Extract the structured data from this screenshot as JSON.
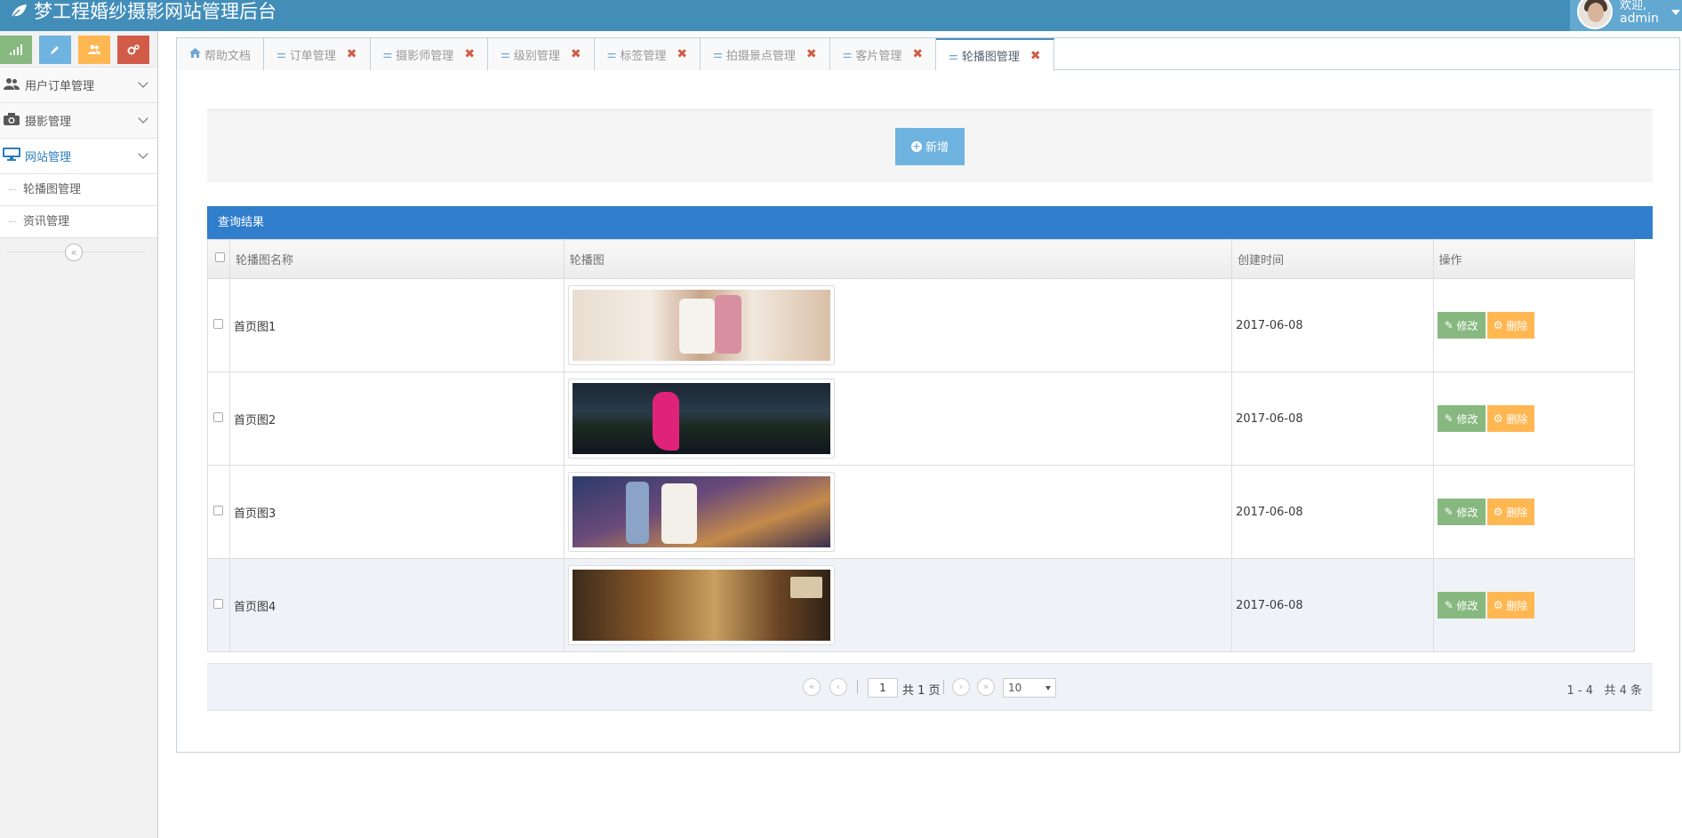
{
  "app": {
    "title": "梦工程婚纱摄影网站管理后台"
  },
  "user": {
    "welcome": "欢迎,",
    "name": "admin"
  },
  "sidebar": {
    "items": [
      {
        "label": "用户订单管理",
        "icon": "users-icon"
      },
      {
        "label": "摄影管理",
        "icon": "camera-icon"
      },
      {
        "label": "网站管理",
        "icon": "desktop-icon"
      }
    ],
    "subitems": [
      {
        "label": "轮播图管理"
      },
      {
        "label": "资讯管理"
      }
    ]
  },
  "tabs": [
    {
      "label": "帮助文档",
      "icon": "home-icon"
    },
    {
      "label": "订单管理"
    },
    {
      "label": "摄影师管理"
    },
    {
      "label": "级别管理"
    },
    {
      "label": "标签管理"
    },
    {
      "label": "拍摄景点管理"
    },
    {
      "label": "客片管理"
    },
    {
      "label": "轮播图管理"
    }
  ],
  "toolbar": {
    "add_label": "新增"
  },
  "results": {
    "title": "查询结果",
    "columns": [
      "轮播图名称",
      "轮播图",
      "创建时间",
      "操作"
    ],
    "rows": [
      {
        "name": "首页图1",
        "created": "2017-06-08"
      },
      {
        "name": "首页图2",
        "created": "2017-06-08"
      },
      {
        "name": "首页图3",
        "created": "2017-06-08"
      },
      {
        "name": "首页图4",
        "created": "2017-06-08"
      }
    ],
    "edit_label": "修改",
    "delete_label": "删除"
  },
  "pager": {
    "page": "1",
    "total_pages_text": "共 1 页",
    "page_size": "10",
    "range_text": "1 - 4",
    "total_text": "共 4 条"
  },
  "colors": {
    "navbar": "#438eb9",
    "result_header": "#307ecc",
    "edit": "#87b87f",
    "delete": "#ffb752",
    "add": "#6fb3e0"
  }
}
